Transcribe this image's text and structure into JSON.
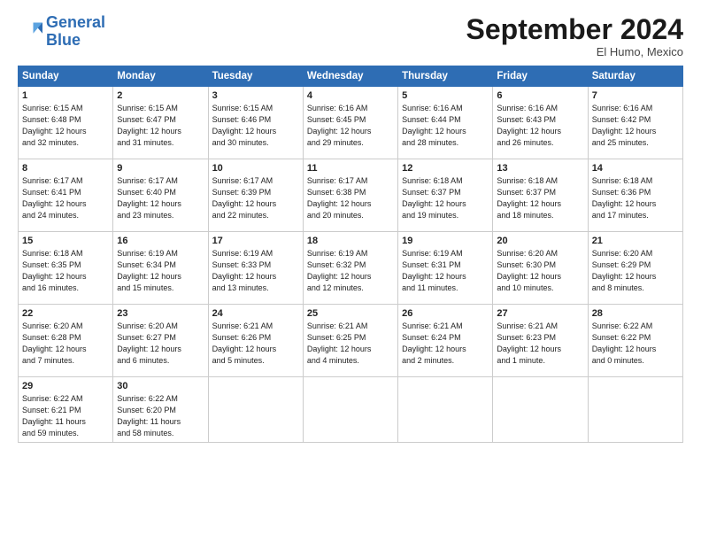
{
  "header": {
    "logo_line1": "General",
    "logo_line2": "Blue",
    "month_title": "September 2024",
    "location": "El Humo, Mexico"
  },
  "days_of_week": [
    "Sunday",
    "Monday",
    "Tuesday",
    "Wednesday",
    "Thursday",
    "Friday",
    "Saturday"
  ],
  "weeks": [
    [
      {
        "day": "1",
        "lines": [
          "Sunrise: 6:15 AM",
          "Sunset: 6:48 PM",
          "Daylight: 12 hours",
          "and 32 minutes."
        ]
      },
      {
        "day": "2",
        "lines": [
          "Sunrise: 6:15 AM",
          "Sunset: 6:47 PM",
          "Daylight: 12 hours",
          "and 31 minutes."
        ]
      },
      {
        "day": "3",
        "lines": [
          "Sunrise: 6:15 AM",
          "Sunset: 6:46 PM",
          "Daylight: 12 hours",
          "and 30 minutes."
        ]
      },
      {
        "day": "4",
        "lines": [
          "Sunrise: 6:16 AM",
          "Sunset: 6:45 PM",
          "Daylight: 12 hours",
          "and 29 minutes."
        ]
      },
      {
        "day": "5",
        "lines": [
          "Sunrise: 6:16 AM",
          "Sunset: 6:44 PM",
          "Daylight: 12 hours",
          "and 28 minutes."
        ]
      },
      {
        "day": "6",
        "lines": [
          "Sunrise: 6:16 AM",
          "Sunset: 6:43 PM",
          "Daylight: 12 hours",
          "and 26 minutes."
        ]
      },
      {
        "day": "7",
        "lines": [
          "Sunrise: 6:16 AM",
          "Sunset: 6:42 PM",
          "Daylight: 12 hours",
          "and 25 minutes."
        ]
      }
    ],
    [
      {
        "day": "8",
        "lines": [
          "Sunrise: 6:17 AM",
          "Sunset: 6:41 PM",
          "Daylight: 12 hours",
          "and 24 minutes."
        ]
      },
      {
        "day": "9",
        "lines": [
          "Sunrise: 6:17 AM",
          "Sunset: 6:40 PM",
          "Daylight: 12 hours",
          "and 23 minutes."
        ]
      },
      {
        "day": "10",
        "lines": [
          "Sunrise: 6:17 AM",
          "Sunset: 6:39 PM",
          "Daylight: 12 hours",
          "and 22 minutes."
        ]
      },
      {
        "day": "11",
        "lines": [
          "Sunrise: 6:17 AM",
          "Sunset: 6:38 PM",
          "Daylight: 12 hours",
          "and 20 minutes."
        ]
      },
      {
        "day": "12",
        "lines": [
          "Sunrise: 6:18 AM",
          "Sunset: 6:37 PM",
          "Daylight: 12 hours",
          "and 19 minutes."
        ]
      },
      {
        "day": "13",
        "lines": [
          "Sunrise: 6:18 AM",
          "Sunset: 6:37 PM",
          "Daylight: 12 hours",
          "and 18 minutes."
        ]
      },
      {
        "day": "14",
        "lines": [
          "Sunrise: 6:18 AM",
          "Sunset: 6:36 PM",
          "Daylight: 12 hours",
          "and 17 minutes."
        ]
      }
    ],
    [
      {
        "day": "15",
        "lines": [
          "Sunrise: 6:18 AM",
          "Sunset: 6:35 PM",
          "Daylight: 12 hours",
          "and 16 minutes."
        ]
      },
      {
        "day": "16",
        "lines": [
          "Sunrise: 6:19 AM",
          "Sunset: 6:34 PM",
          "Daylight: 12 hours",
          "and 15 minutes."
        ]
      },
      {
        "day": "17",
        "lines": [
          "Sunrise: 6:19 AM",
          "Sunset: 6:33 PM",
          "Daylight: 12 hours",
          "and 13 minutes."
        ]
      },
      {
        "day": "18",
        "lines": [
          "Sunrise: 6:19 AM",
          "Sunset: 6:32 PM",
          "Daylight: 12 hours",
          "and 12 minutes."
        ]
      },
      {
        "day": "19",
        "lines": [
          "Sunrise: 6:19 AM",
          "Sunset: 6:31 PM",
          "Daylight: 12 hours",
          "and 11 minutes."
        ]
      },
      {
        "day": "20",
        "lines": [
          "Sunrise: 6:20 AM",
          "Sunset: 6:30 PM",
          "Daylight: 12 hours",
          "and 10 minutes."
        ]
      },
      {
        "day": "21",
        "lines": [
          "Sunrise: 6:20 AM",
          "Sunset: 6:29 PM",
          "Daylight: 12 hours",
          "and 8 minutes."
        ]
      }
    ],
    [
      {
        "day": "22",
        "lines": [
          "Sunrise: 6:20 AM",
          "Sunset: 6:28 PM",
          "Daylight: 12 hours",
          "and 7 minutes."
        ]
      },
      {
        "day": "23",
        "lines": [
          "Sunrise: 6:20 AM",
          "Sunset: 6:27 PM",
          "Daylight: 12 hours",
          "and 6 minutes."
        ]
      },
      {
        "day": "24",
        "lines": [
          "Sunrise: 6:21 AM",
          "Sunset: 6:26 PM",
          "Daylight: 12 hours",
          "and 5 minutes."
        ]
      },
      {
        "day": "25",
        "lines": [
          "Sunrise: 6:21 AM",
          "Sunset: 6:25 PM",
          "Daylight: 12 hours",
          "and 4 minutes."
        ]
      },
      {
        "day": "26",
        "lines": [
          "Sunrise: 6:21 AM",
          "Sunset: 6:24 PM",
          "Daylight: 12 hours",
          "and 2 minutes."
        ]
      },
      {
        "day": "27",
        "lines": [
          "Sunrise: 6:21 AM",
          "Sunset: 6:23 PM",
          "Daylight: 12 hours",
          "and 1 minute."
        ]
      },
      {
        "day": "28",
        "lines": [
          "Sunrise: 6:22 AM",
          "Sunset: 6:22 PM",
          "Daylight: 12 hours",
          "and 0 minutes."
        ]
      }
    ],
    [
      {
        "day": "29",
        "lines": [
          "Sunrise: 6:22 AM",
          "Sunset: 6:21 PM",
          "Daylight: 11 hours",
          "and 59 minutes."
        ]
      },
      {
        "day": "30",
        "lines": [
          "Sunrise: 6:22 AM",
          "Sunset: 6:20 PM",
          "Daylight: 11 hours",
          "and 58 minutes."
        ]
      },
      {
        "day": "",
        "lines": []
      },
      {
        "day": "",
        "lines": []
      },
      {
        "day": "",
        "lines": []
      },
      {
        "day": "",
        "lines": []
      },
      {
        "day": "",
        "lines": []
      }
    ]
  ]
}
